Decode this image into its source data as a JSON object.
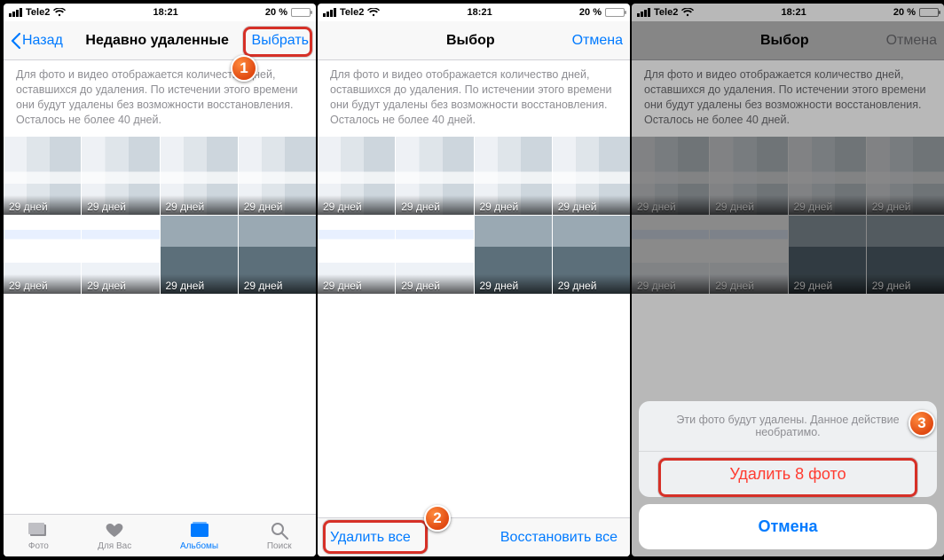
{
  "status": {
    "carrier": "Tele2",
    "time": "18:21",
    "battery_pct": "20 %"
  },
  "screen1": {
    "back": "Назад",
    "title": "Недавно удаленные",
    "select": "Выбрать"
  },
  "screen2": {
    "title": "Выбор",
    "cancel": "Отмена",
    "delete_all": "Удалить все",
    "recover_all": "Восстановить все"
  },
  "screen3": {
    "title": "Выбор",
    "cancel": "Отмена",
    "sheet_msg": "Эти фото будут удалены. Данное действие необратимо.",
    "delete_n": "Удалить 8 фото",
    "sheet_cancel": "Отмена"
  },
  "desc": "Для фото и видео отображается количество дней, оставшихся до удаления. По истечении этого времени они будут удалены без возможности восстановления. Осталось не более 40 дней.",
  "thumb_days": "29 дней",
  "tabs": {
    "photos": "Фото",
    "for_you": "Для Вас",
    "albums": "Альбомы",
    "search": "Поиск"
  },
  "annotations": {
    "b1": "1",
    "b2": "2",
    "b3": "3"
  }
}
